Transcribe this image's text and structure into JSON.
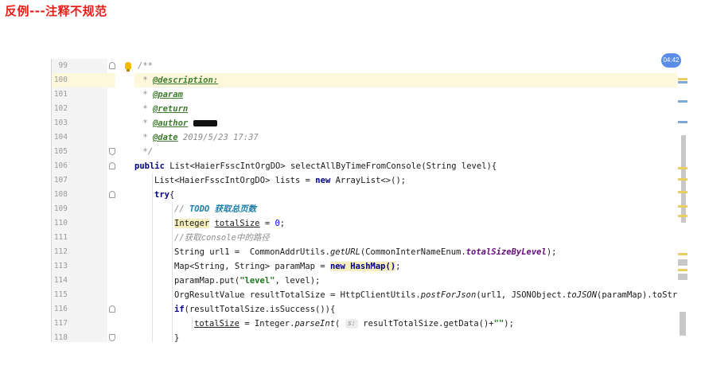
{
  "page_title": "反例---注释不规范",
  "time_badge": "04:42",
  "editor": {
    "line_numbers": [
      "99",
      "100",
      "101",
      "102",
      "103",
      "104",
      "105",
      "106",
      "107",
      "108",
      "109",
      "110",
      "111",
      "112",
      "113",
      "114",
      "115",
      "116",
      "117",
      "118"
    ],
    "lines": {
      "l99": "/**",
      "l100_tag": "@description:",
      "l101_tag": "@param",
      "l102_tag": "@return",
      "l103_tag": "@author",
      "l104_tag": "@date",
      "l104_val": " 2019/5/23 17:37",
      "l105": "*/",
      "l106_kw": "public",
      "l106_rest": " List<HaierFsscIntOrgDO> selectAllByTimeFromConsole(String level){",
      "l107_a": "List<HaierFsscIntOrgDO> lists = ",
      "l107_kw": "new",
      "l107_b": " ArrayList<>();",
      "l108_kw": "try",
      "l108_b": "{",
      "l109_a": "// ",
      "l109_todo": "TODO 获取总页数",
      "l110_type": "Integer",
      "l110_field": "totalSize",
      "l110_eq": " = ",
      "l110_num": "0",
      "l110_end": ";",
      "l111": "//获取console中的路径",
      "l112_a": "String url1 =  CommonAddrUtils.",
      "l112_m": "getURL",
      "l112_b": "(CommonInterNameEnum.",
      "l112_s": "totalSizeByLevel",
      "l112_c": ");",
      "l113_a": "Map<String, String> paramMap = ",
      "l113_new": "new HashMap()",
      "l113_c": ";",
      "l114_a": "paramMap.put(",
      "l114_str": "\"level\"",
      "l114_b": ", level);",
      "l115_a": "OrgResultValue resultTotalSize = HttpClientUtils.",
      "l115_m": "postForJson",
      "l115_b": "(url1, JSONObject.",
      "l115_m2": "toJSON",
      "l115_c": "(paramMap).toString(), (",
      "l116_kw": "if",
      "l116_b": "(resultTotalSize.isSuccess()){",
      "l117_field": "totalSize",
      "l117_a": " = Integer.",
      "l117_m": "parseInt",
      "l117_b": "( ",
      "l117_hint": "s:",
      "l117_c": " resultTotalSize.getData()+",
      "l117_str": "\"\"",
      "l117_d": ");",
      "l118": "}"
    }
  }
}
